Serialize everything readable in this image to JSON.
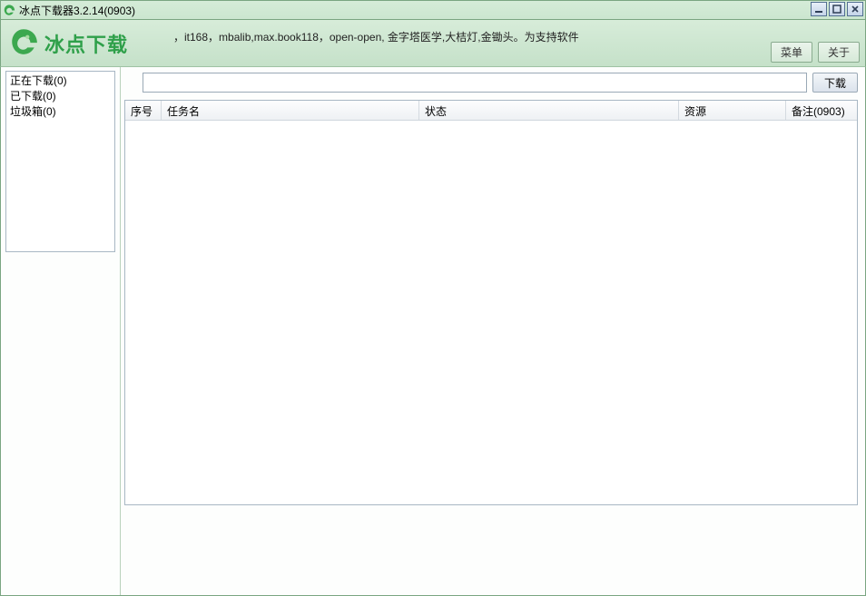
{
  "titlebar": {
    "text": "冰点下载器3.2.14(0903)"
  },
  "header": {
    "logo_text": "冰点下载",
    "ticker": "，it168，mbalib,max.book118，open-open, 金字塔医学,大桔灯,金锄头。为支持软件",
    "menu_btn": "菜单",
    "about_btn": "关于"
  },
  "sidebar": {
    "items": [
      {
        "label": "正在下载(0)"
      },
      {
        "label": "已下载(0)"
      },
      {
        "label": "垃圾箱(0)"
      }
    ]
  },
  "urlbar": {
    "value": "",
    "download_btn": "下载"
  },
  "table": {
    "columns": {
      "seq": "序号",
      "name": "任务名",
      "status": "状态",
      "resource": "资源",
      "note": "备注(0903)"
    },
    "rows": []
  }
}
